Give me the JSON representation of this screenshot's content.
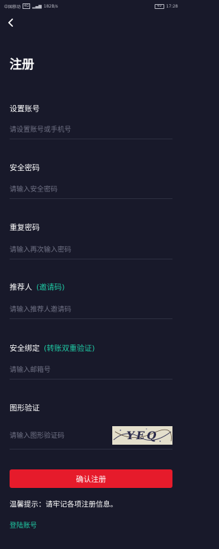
{
  "status_bar": {
    "left_text": "中国移动",
    "network": "4G",
    "speed": "182B/s",
    "battery": "49",
    "time": "17:28"
  },
  "header": {
    "title": "注册"
  },
  "fields": {
    "account": {
      "label": "设置账号",
      "placeholder": "请设置账号或手机号"
    },
    "password": {
      "label": "安全密码",
      "placeholder": "请输入安全密码"
    },
    "repeat_password": {
      "label": "重复密码",
      "placeholder": "请输入再次输入密码"
    },
    "referrer": {
      "label": "推荐人",
      "note": "(邀请码)",
      "placeholder": "请输入推荐人邀请码"
    },
    "email": {
      "label": "安全绑定",
      "note": "(转账双重验证)",
      "placeholder": "请输入邮箱号"
    },
    "captcha": {
      "label": "图形验证",
      "placeholder": "请输入图形验证码",
      "image_text": "YEQ"
    }
  },
  "submit": {
    "label": "确认注册"
  },
  "tip": {
    "text": "温馨提示：请牢记各项注册信息。"
  },
  "login_link": {
    "label": "登陆账号"
  },
  "colors": {
    "background": "#18192a",
    "accent": "#1fc8a3",
    "button": "#e61b2b"
  }
}
